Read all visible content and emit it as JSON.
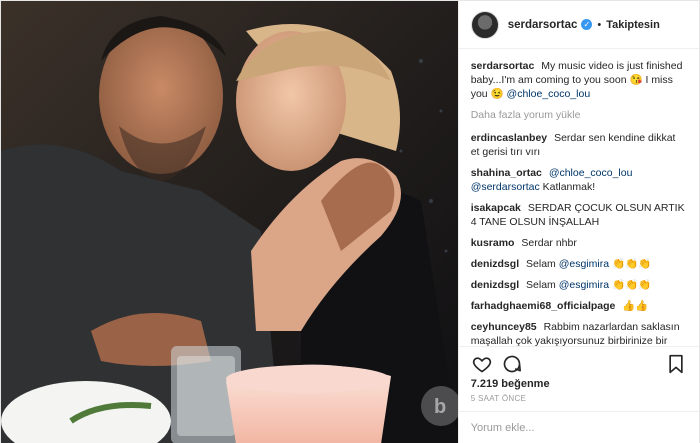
{
  "header": {
    "username": "serdarsortac",
    "verified_icon": "verified-badge-icon",
    "separator": "•",
    "follow_label": "Takiptesin"
  },
  "caption": {
    "user": "serdarsortac",
    "text_before": "My music video is just finished baby...I'm am coming to you soon 😘 I miss you 😉",
    "mention": "@chloe_coco_lou"
  },
  "load_more_label": "Daha fazla yorum yükle",
  "comments": [
    {
      "user": "erdincaslanbey",
      "text": "Serdar sen kendine dikkat et gerisi tırı vırı",
      "mention": ""
    },
    {
      "user": "shahina_ortac",
      "text": "Katlanmak!",
      "mention": "@chloe_coco_lou @serdarsortac"
    },
    {
      "user": "isakapcak",
      "text": "SERDAR ÇOCUK OLSUN ARTIK 4 TANE OLSUN İNŞALLAH",
      "mention": ""
    },
    {
      "user": "kusramo",
      "text": "Serdar nhbr",
      "mention": ""
    },
    {
      "user": "denizdsgl",
      "text": "Selam",
      "mention": "@esgimira",
      "emoji": "👏👏👏"
    },
    {
      "user": "denizdsgl",
      "text": "Selam",
      "mention": "@esgimira",
      "emoji": "👏👏👏"
    },
    {
      "user": "farhadghaemi68_officialpage",
      "text": "",
      "mention": "",
      "emoji": "👍👍"
    },
    {
      "user": "ceyhuncey85",
      "text": "Rabbim nazarlardan saklasın maşallah çok yakışıyorsunuz birbirinize bir",
      "mention": ""
    }
  ],
  "likes": "7.219 beğenme",
  "time": "5 SAAT ÖNCE",
  "add_comment": {
    "placeholder": "Yorum ekle..."
  },
  "icons": {
    "like": "heart-icon",
    "comment": "comment-icon",
    "save": "bookmark-icon"
  },
  "colors": {
    "link": "#003569",
    "verified": "#3897f0",
    "muted": "#999999"
  }
}
